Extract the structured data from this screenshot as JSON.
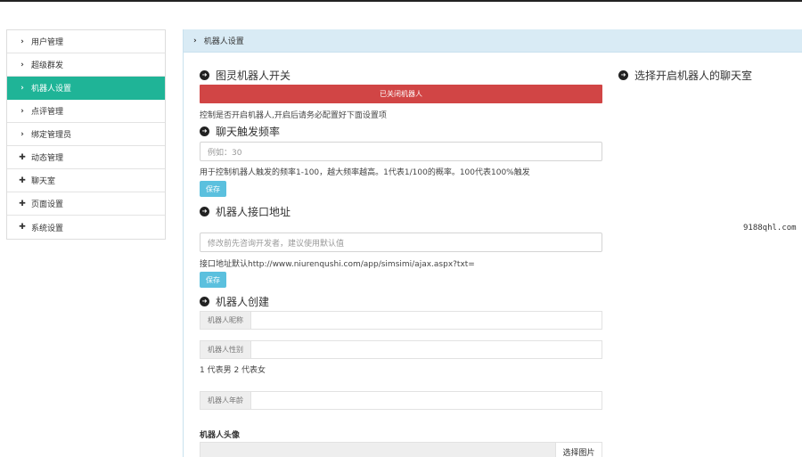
{
  "sidebar": {
    "items": [
      {
        "icon": "chevron-right-icon",
        "glyph": "›",
        "label": "用户管理",
        "active": false
      },
      {
        "icon": "chevron-right-icon",
        "glyph": "›",
        "label": "超级群发",
        "active": false
      },
      {
        "icon": "chevron-right-icon",
        "glyph": "›",
        "label": "机器人设置",
        "active": true
      },
      {
        "icon": "chevron-right-icon",
        "glyph": "›",
        "label": "点评管理",
        "active": false
      },
      {
        "icon": "chevron-right-icon",
        "glyph": "›",
        "label": "绑定管理员",
        "active": false
      },
      {
        "icon": "plus-icon",
        "glyph": "✚",
        "label": "动态管理",
        "active": false
      },
      {
        "icon": "plus-icon",
        "glyph": "✚",
        "label": "聊天室",
        "active": false
      },
      {
        "icon": "plus-icon",
        "glyph": "✚",
        "label": "页面设置",
        "active": false
      },
      {
        "icon": "plus-icon",
        "glyph": "✚",
        "label": "系统设置",
        "active": false
      }
    ]
  },
  "breadcrumb": {
    "icon": "chevron-right-icon",
    "label": "机器人设置"
  },
  "switch_section": {
    "title": "图灵机器人开关",
    "button_label": "已关闭机器人",
    "help": "控制是否开启机器人,开启后请务必配置好下面设置项"
  },
  "frequency_section": {
    "title": "聊天触发频率",
    "placeholder": "例如：30",
    "help": "用于控制机器人触发的频率1-100，越大频率越高。1代表1/100的概率。100代表100%触发",
    "save_label": "保存"
  },
  "api_section": {
    "title": "机器人接口地址",
    "placeholder": "修改前先咨询开发者，建议使用默认值",
    "help": "接口地址默认http://www.niurenqushi.com/app/simsimi/ajax.aspx?txt=",
    "save_label": "保存"
  },
  "create_section": {
    "title": "机器人创建",
    "nickname_label": "机器人昵称",
    "gender_label": "机器人性别",
    "gender_help": "1 代表男 2 代表女",
    "age_label": "机器人年龄",
    "avatar_label": "机器人头像",
    "choose_image_label": "选择图片"
  },
  "right_panel": {
    "title": "选择开启机器人的聊天室"
  },
  "watermark": "9188qhl.com",
  "colors": {
    "active": "#1fb497",
    "danger": "#d14545",
    "info": "#5bc0de",
    "breadcrumb_bg": "#d9ebf5"
  }
}
